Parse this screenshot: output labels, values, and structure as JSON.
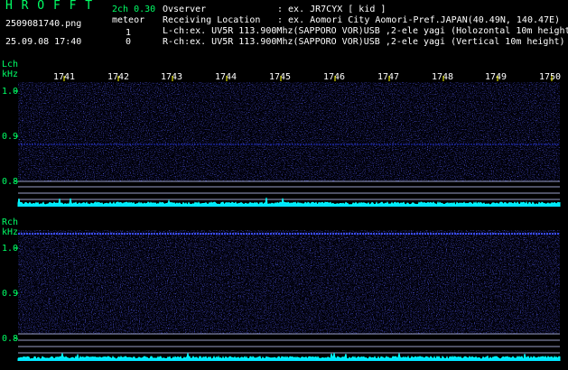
{
  "header": {
    "title": "H R O F F T",
    "mode": "2ch 0.30",
    "meteor_label": "meteor",
    "filename": "2509081740.png",
    "datetime": "25.09.08 17:40",
    "lch_count": "1",
    "rch_count": "0"
  },
  "info": {
    "observer_label": "Ovserver",
    "observer_value": ": ex. JR7CYX [ kid ]",
    "location_label": "Receiving Location",
    "location_value": ": ex. Aomori City Aomori-Pref.JAPAN(40.49N, 140.47E)",
    "lch_line": "L-ch:ex. UV5R 113.900Mhz(SAPPORO VOR)USB ,2-ele yagi (Holozontal 10m height)",
    "rch_line": "R-ch:ex. UV5R 113.900Mhz(SAPPORO VOR)USB ,2-ele yagi (Vertical 10m height)"
  },
  "lch": {
    "label": "Lch",
    "unit": "kHz",
    "time_ticks": [
      "1741",
      "1742",
      "1743",
      "1744",
      "1745",
      "1746",
      "1747",
      "1748",
      "1749",
      "1750"
    ],
    "freq_ticks": [
      "1.0",
      "0.9",
      "0.8"
    ]
  },
  "rch": {
    "label": "Rch",
    "unit": "kHz",
    "freq_ticks": [
      "1.0",
      "0.9",
      "0.8"
    ]
  },
  "colors": {
    "label_green": "#00ff66",
    "text_white": "#ffffff",
    "tick_yellow": "#ffff00",
    "level_cyan": "#00ffff",
    "noise_blue": "#1a1aa0"
  }
}
